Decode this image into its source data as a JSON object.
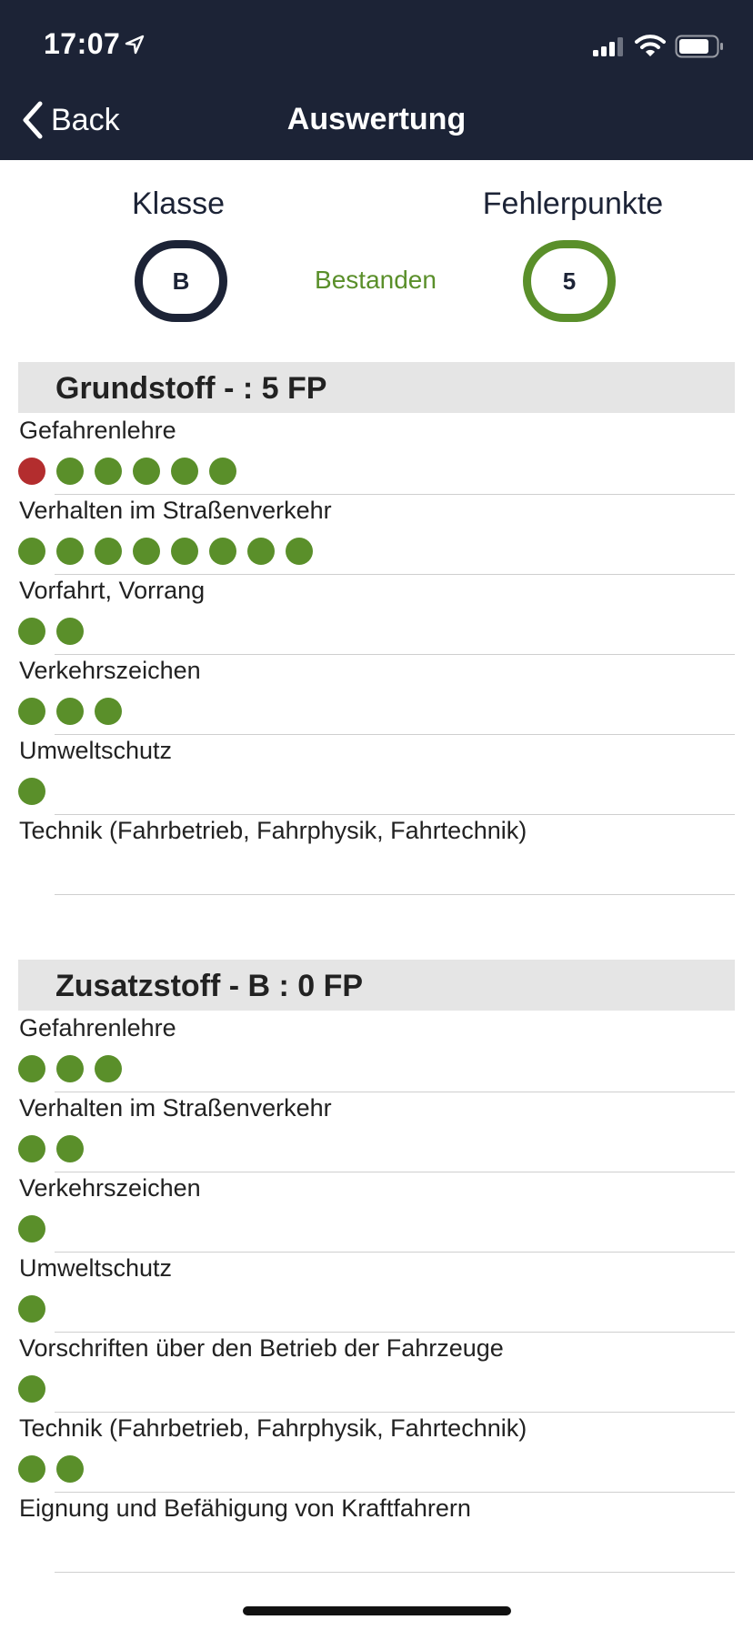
{
  "status_bar": {
    "time": "17:07"
  },
  "nav": {
    "back_label": "Back",
    "title": "Auswertung"
  },
  "summary": {
    "class_label": "Klasse",
    "class_value": "B",
    "result": "Bestanden",
    "points_label": "Fehlerpunkte",
    "points_value": "5"
  },
  "colors": {
    "header_bg": "#1c2336",
    "correct": "#5a8f2a",
    "wrong": "#b32d2e",
    "section_bg": "#e5e5e5"
  },
  "sections": [
    {
      "title": "Grundstoff - : 5 FP",
      "categories": [
        {
          "label": "Gefahrenlehre",
          "results": [
            "wrong",
            "correct",
            "correct",
            "correct",
            "correct",
            "correct"
          ]
        },
        {
          "label": "Verhalten im Straßenverkehr",
          "results": [
            "correct",
            "correct",
            "correct",
            "correct",
            "correct",
            "correct",
            "correct",
            "correct"
          ]
        },
        {
          "label": "Vorfahrt, Vorrang",
          "results": [
            "correct",
            "correct"
          ]
        },
        {
          "label": "Verkehrszeichen",
          "results": [
            "correct",
            "correct",
            "correct"
          ]
        },
        {
          "label": "Umweltschutz",
          "results": [
            "correct"
          ]
        },
        {
          "label": "Technik (Fahrbetrieb, Fahrphysik, Fahrtechnik)",
          "results": []
        }
      ]
    },
    {
      "title": "Zusatzstoff - B : 0 FP",
      "categories": [
        {
          "label": "Gefahrenlehre",
          "results": [
            "correct",
            "correct",
            "correct"
          ]
        },
        {
          "label": "Verhalten im Straßenverkehr",
          "results": [
            "correct",
            "correct"
          ]
        },
        {
          "label": "Verkehrszeichen",
          "results": [
            "correct"
          ]
        },
        {
          "label": "Umweltschutz",
          "results": [
            "correct"
          ]
        },
        {
          "label": "Vorschriften über den Betrieb der Fahrzeuge",
          "results": [
            "correct"
          ]
        },
        {
          "label": "Technik (Fahrbetrieb, Fahrphysik, Fahrtechnik)",
          "results": [
            "correct",
            "correct"
          ]
        },
        {
          "label": "Eignung und Befähigung von Kraftfahrern",
          "results": []
        }
      ]
    }
  ]
}
